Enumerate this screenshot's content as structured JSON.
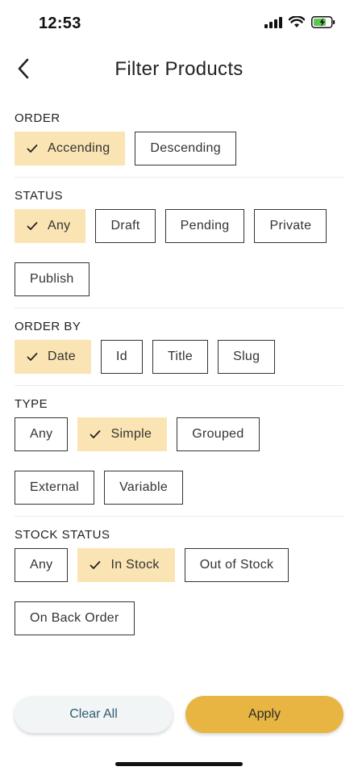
{
  "status_bar": {
    "time": "12:53"
  },
  "header": {
    "title": "Filter Products"
  },
  "sections": [
    {
      "title": "ORDER",
      "options": [
        "Accending",
        "Descending"
      ],
      "selected": 0
    },
    {
      "title": "STATUS",
      "options": [
        "Any",
        "Draft",
        "Pending",
        "Private",
        "Publish"
      ],
      "selected": 0
    },
    {
      "title": "ORDER BY",
      "options": [
        "Date",
        "Id",
        "Title",
        "Slug"
      ],
      "selected": 0
    },
    {
      "title": "TYPE",
      "options": [
        "Any",
        "Simple",
        "Grouped",
        "External",
        "Variable"
      ],
      "selected": 1
    },
    {
      "title": "STOCK STATUS",
      "options": [
        "Any",
        "In Stock",
        "Out of Stock",
        "On Back Order"
      ],
      "selected": 1
    }
  ],
  "actions": {
    "clear_label": "Clear All",
    "apply_label": "Apply"
  },
  "colors": {
    "selected_chip": "#fbe4b3",
    "apply_button": "#e8b543",
    "clear_button": "#f1f5f6",
    "battery": "#5ec752"
  }
}
